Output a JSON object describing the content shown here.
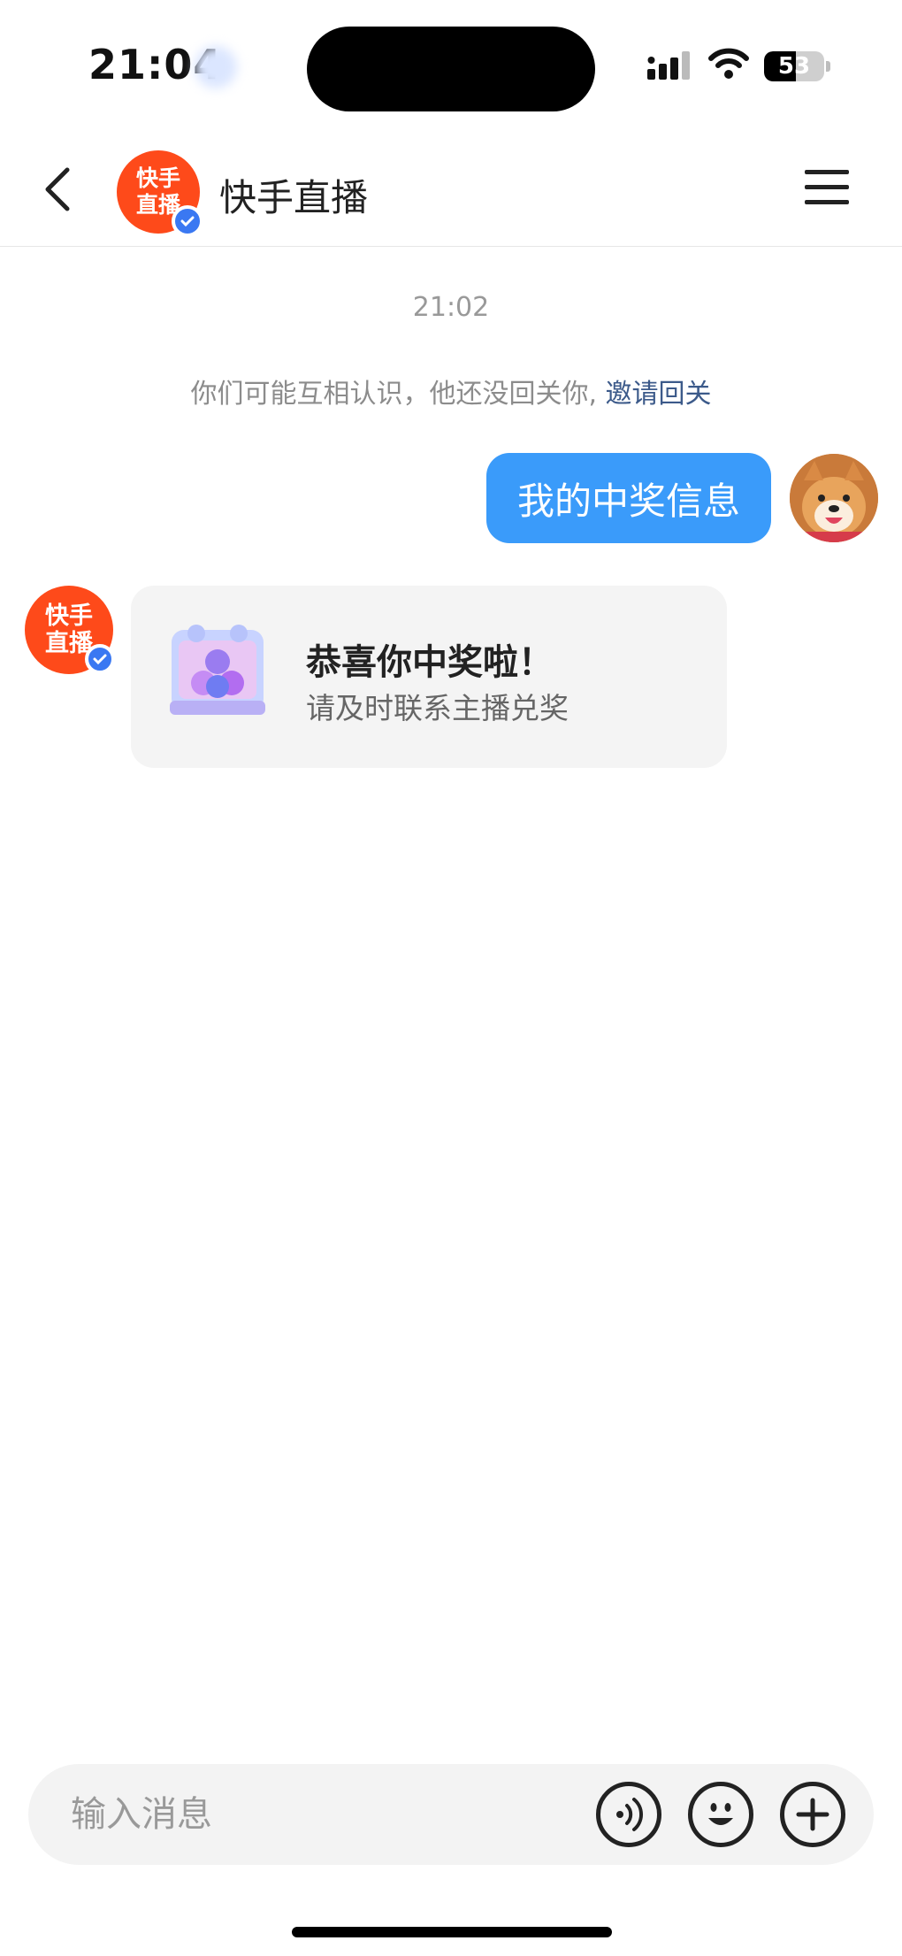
{
  "status_bar": {
    "time": "21:04",
    "battery_text": "53",
    "battery_level_percent": 53
  },
  "header": {
    "avatar_line1": "快手",
    "avatar_line2": "直播",
    "title": "快手直播",
    "back_icon": "chevron-left-icon",
    "menu_icon": "hamburger-menu-icon"
  },
  "chat": {
    "timestamp": "21:02",
    "notice_text": "你们可能互相认识，他还没回关你,",
    "notice_link": "邀请回关",
    "my_message": "我的中奖信息",
    "sender_avatar_line1": "快手",
    "sender_avatar_line2": "直播",
    "card": {
      "title": "恭喜你中奖啦！",
      "subtitle": "请及时联系主播兑奖",
      "icon": "prize-box-icon"
    }
  },
  "input_bar": {
    "placeholder": "输入消息",
    "voice_icon": "voice-icon",
    "emoji_icon": "emoji-icon",
    "plus_icon": "plus-icon"
  },
  "colors": {
    "accent_blue": "#3a9bfa",
    "brand_orange": "#fe4a1a",
    "verified_blue": "#3a78f2",
    "link_color": "#3c5a8a"
  }
}
